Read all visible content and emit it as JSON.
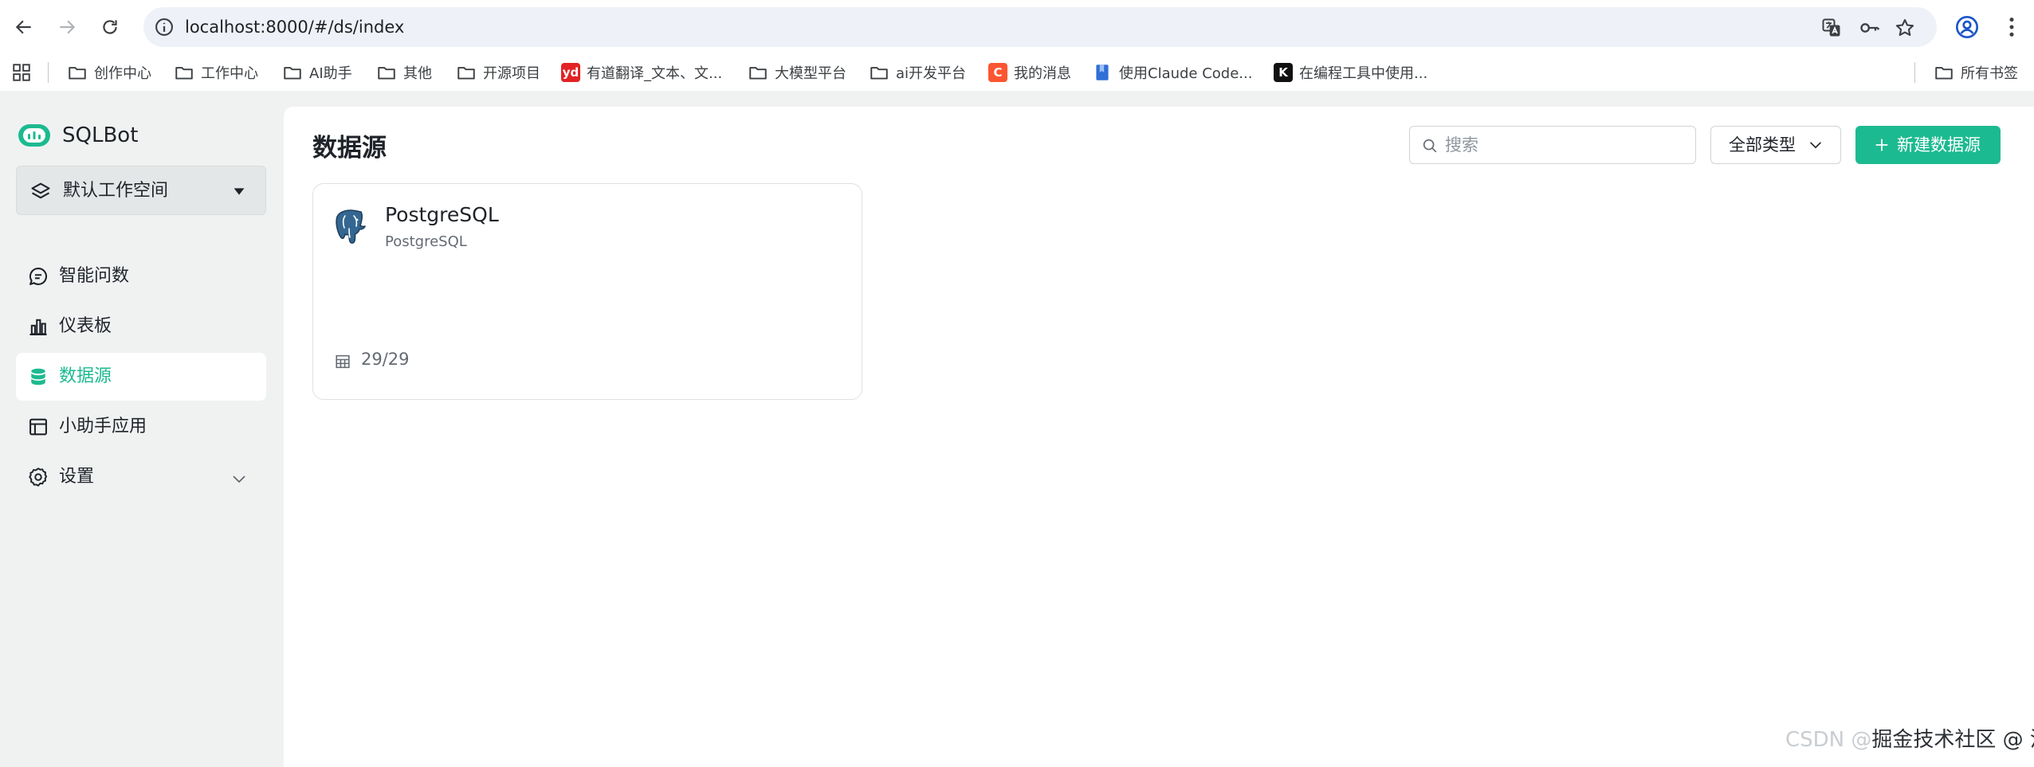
{
  "browser": {
    "url": "localhost:8000/#/ds/index"
  },
  "bookmarks": {
    "items": [
      {
        "label": "创作中心",
        "icon": "folder-icon"
      },
      {
        "label": "工作中心",
        "icon": "folder-icon"
      },
      {
        "label": "AI助手",
        "icon": "folder-icon"
      },
      {
        "label": "其他",
        "icon": "folder-icon"
      },
      {
        "label": "开源项目",
        "icon": "folder-icon"
      },
      {
        "label": "有道翻译_文本、文...",
        "icon": "youdao-icon",
        "fav_text": "yd",
        "color": "#e32225"
      },
      {
        "label": "大模型平台",
        "icon": "folder-icon"
      },
      {
        "label": "ai开发平台",
        "icon": "folder-icon"
      },
      {
        "label": "我的消息",
        "icon": "csdn-icon",
        "fav_text": "C",
        "color": "#fc5531"
      },
      {
        "label": "使用Claude Code...",
        "icon": "bookmark-doc-icon",
        "color": "#2f6fd6"
      },
      {
        "label": "在编程工具中使用...",
        "icon": "kimi-icon",
        "fav_text": "K",
        "color": "#111111"
      }
    ],
    "all_bookmarks": "所有书签"
  },
  "app": {
    "brand": "SQLBot",
    "workspace": "默认工作空间",
    "menu": [
      {
        "label": "智能问数",
        "icon": "chat-icon",
        "active": false
      },
      {
        "label": "仪表板",
        "icon": "bar-chart-icon",
        "active": false
      },
      {
        "label": "数据源",
        "icon": "database-icon",
        "active": true
      },
      {
        "label": "小助手应用",
        "icon": "app-window-icon",
        "active": false
      },
      {
        "label": "设置",
        "icon": "gear-icon",
        "active": false
      }
    ],
    "accent_color": "#1cba90"
  },
  "main": {
    "title": "数据源",
    "search_placeholder": "搜索",
    "type_filter": "全部类型",
    "new_button": "新建数据源",
    "datasources": [
      {
        "name": "PostgreSQL",
        "type": "PostgreSQL",
        "tables": "29/29"
      }
    ]
  },
  "watermark": {
    "ghost": "CSDN @",
    "text": "掘金技术社区 @ 洛阳泰山"
  }
}
